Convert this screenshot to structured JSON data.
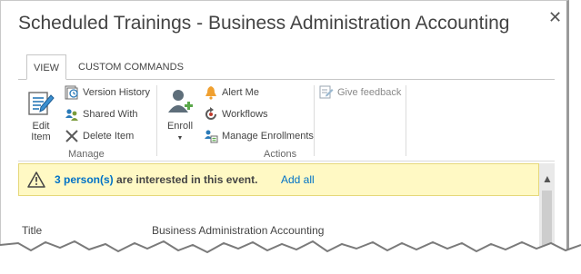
{
  "dialog": {
    "title": "Scheduled Trainings - Business Administration Accounting",
    "close_icon": "close-icon"
  },
  "tabs": [
    {
      "label": "VIEW",
      "selected": true
    },
    {
      "label": "CUSTOM COMMANDS",
      "selected": false
    }
  ],
  "ribbon": {
    "manage": {
      "label": "Manage",
      "edit_item_line1": "Edit",
      "edit_item_line2": "Item",
      "version_history": "Version History",
      "shared_with": "Shared With",
      "delete_item": "Delete Item"
    },
    "actions": {
      "label": "Actions",
      "enroll": "Enroll",
      "alert_me": "Alert Me",
      "workflows": "Workflows",
      "manage_enrollments": "Manage Enrollments"
    },
    "feedback": {
      "give_feedback": "Give feedback"
    }
  },
  "banner": {
    "link_text": "3 person(s)",
    "message": " are interested in this event.",
    "add_all": "Add all"
  },
  "form": {
    "title_label": "Title",
    "title_value": "Business Administration Accounting"
  },
  "colors": {
    "link": "#0072c6",
    "banner_bg": "#fff9c4",
    "alert_orange": "#f0a030",
    "delete_gray": "#5a5a5a"
  }
}
